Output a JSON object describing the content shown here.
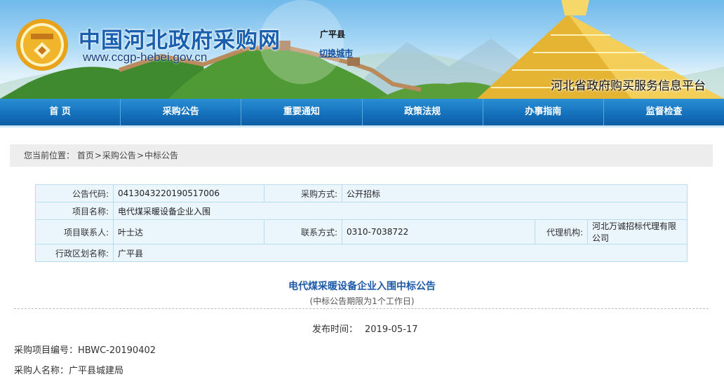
{
  "banner": {
    "site_title": "中国河北政府采购网",
    "site_url": "www.ccgp-hebei.gov.cn",
    "city": "广平县",
    "switch_city": "切换城市",
    "platform": "河北省政府购买服务信息平台"
  },
  "nav": [
    "首  页",
    "采购公告",
    "重要通知",
    "政策法规",
    "办事指南",
    "监督检查"
  ],
  "breadcrumb": {
    "label": "您当前位置：",
    "items": [
      "首页",
      "采购公告",
      "中标公告"
    ]
  },
  "info": {
    "code_label": "公告代码:",
    "code": "0413043220190517006",
    "method_label": "采购方式:",
    "method": "公开招标",
    "project_label": "项目名称:",
    "project": "电代煤采暖设备企业入围",
    "contact_label": "项目联系人:",
    "contact": "叶士达",
    "phone_label": "联系方式:",
    "phone": "0310-7038722",
    "agency_label": "代理机构:",
    "agency": "河北万诚招标代理有限公司",
    "region_label": "行政区划名称:",
    "region": "广平县"
  },
  "notice": {
    "title": "电代煤采暖设备企业入围中标公告",
    "subtitle": "(中标公告期限为1个工作日)",
    "pub_label": "发布时间：",
    "pub_date": "2019-05-17",
    "project_no": "采购项目编号：HBWC-20190402",
    "purchaser": "采购人名称：广平县城建局"
  }
}
